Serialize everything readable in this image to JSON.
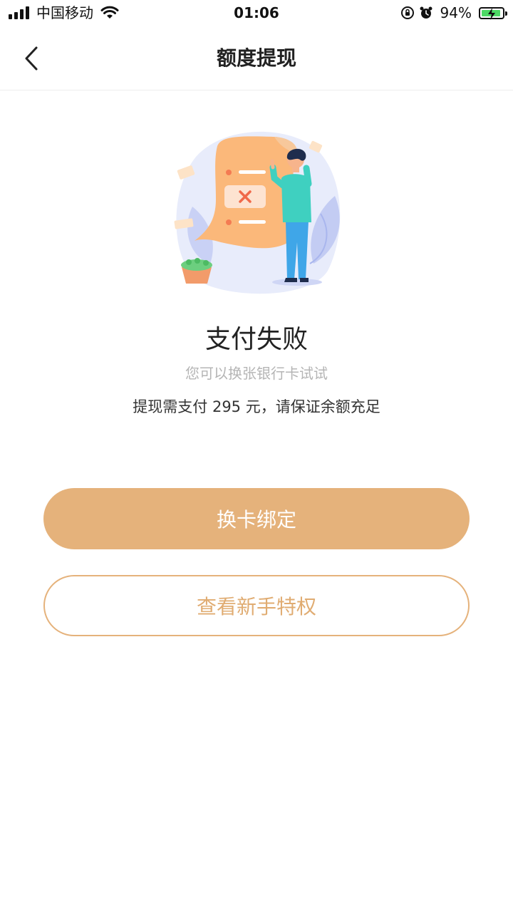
{
  "status_bar": {
    "carrier": "中国移动",
    "time": "01:06",
    "battery_percent": "94%",
    "battery_level": 0.94,
    "icons": [
      "signal-icon",
      "wifi-icon",
      "orientation-lock-icon",
      "alarm-icon",
      "battery-charging-icon"
    ]
  },
  "nav": {
    "title": "额度提现",
    "back_icon": "chevron-left-icon"
  },
  "result": {
    "title": "支付失败",
    "subtitle": "您可以换张银行卡试试",
    "message": "提现需支付 295 元，请保证余额充足"
  },
  "actions": {
    "primary_label": "换卡绑定",
    "secondary_label": "查看新手特权"
  },
  "colors": {
    "accent": "#e5b27b",
    "title_text": "#222222",
    "subtitle_text": "#b5b5b5"
  }
}
